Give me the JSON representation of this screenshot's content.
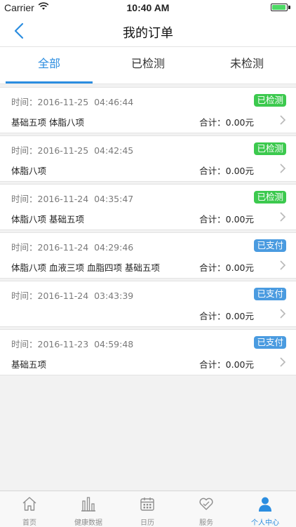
{
  "status_bar": {
    "carrier": "Carrier",
    "time": "10:40 AM"
  },
  "nav": {
    "title": "我的订单"
  },
  "tabs": [
    {
      "label": "全部",
      "active": true
    },
    {
      "label": "已检测",
      "active": false
    },
    {
      "label": "未检测",
      "active": false
    }
  ],
  "orders": [
    {
      "time": "时间：2016-11-25  04:46:44",
      "status": "已检测",
      "status_color": "#3cc94e",
      "items": "基础五项 体脂八项",
      "total": "合计：0.00元"
    },
    {
      "time": "时间：2016-11-25  04:42:45",
      "status": "已检测",
      "status_color": "#3cc94e",
      "items": "体脂八项",
      "total": "合计：0.00元"
    },
    {
      "time": "时间：2016-11-24  04:35:47",
      "status": "已检测",
      "status_color": "#3cc94e",
      "items": "体脂八项 基础五项",
      "total": "合计：0.00元"
    },
    {
      "time": "时间：2016-11-24  04:29:46",
      "status": "已支付",
      "status_color": "#4a9be0",
      "items": "体脂八项 血液三项 血脂四项 基础五项",
      "total": "合计：0.00元"
    },
    {
      "time": "时间：2016-11-24  03:43:39",
      "status": "已支付",
      "status_color": "#4a9be0",
      "items": "",
      "total": "合计：0.00元"
    },
    {
      "time": "时间：2016-11-23  04:59:48",
      "status": "已支付",
      "status_color": "#4a9be0",
      "items": "基础五项",
      "total": "合计：0.00元"
    }
  ],
  "tabbar": [
    {
      "label": "首页",
      "icon": "home-icon",
      "active": false
    },
    {
      "label": "健康数据",
      "icon": "bar-chart-icon",
      "active": false
    },
    {
      "label": "日历",
      "icon": "calendar-icon",
      "active": false
    },
    {
      "label": "服务",
      "icon": "heart-icon",
      "active": false
    },
    {
      "label": "个人中心",
      "icon": "person-icon",
      "active": true
    }
  ],
  "colors": {
    "accent": "#2b8de0",
    "checked": "#3cc94e",
    "paid": "#4a9be0"
  }
}
